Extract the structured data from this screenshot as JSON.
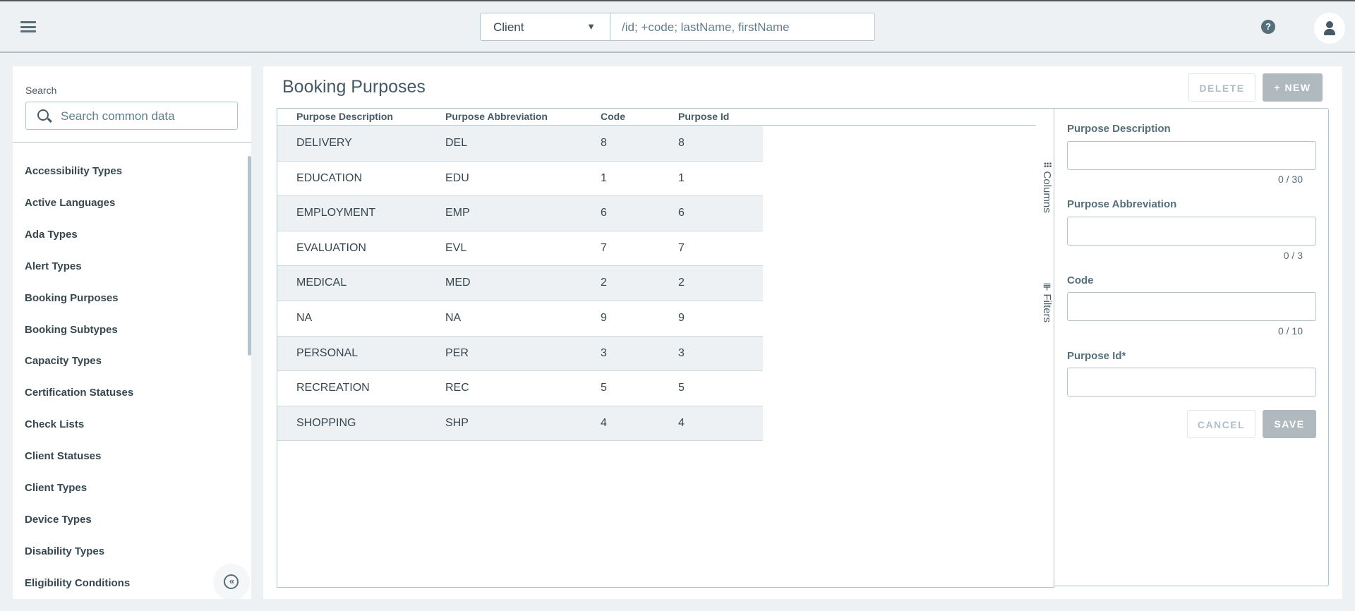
{
  "header": {
    "entity_select": "Client",
    "search_placeholder": "/id; +code; lastName, firstName",
    "help": "?"
  },
  "sidebar": {
    "search_label": "Search",
    "search_placeholder": "Search common data",
    "items": [
      "Accessibility Types",
      "Active Languages",
      "Ada Types",
      "Alert Types",
      "Booking Purposes",
      "Booking Subtypes",
      "Capacity Types",
      "Certification Statuses",
      "Check Lists",
      "Client Statuses",
      "Client Types",
      "Device Types",
      "Disability Types",
      "Eligibility Conditions"
    ],
    "collapse": "«"
  },
  "main": {
    "title": "Booking Purposes",
    "delete_label": "DELETE",
    "new_label": "+ NEW",
    "columns": [
      "Purpose Description",
      "Purpose Abbreviation",
      "Code",
      "Purpose Id"
    ],
    "rows": [
      [
        "DELIVERY",
        "DEL",
        "8",
        "8"
      ],
      [
        "EDUCATION",
        "EDU",
        "1",
        "1"
      ],
      [
        "EMPLOYMENT",
        "EMP",
        "6",
        "6"
      ],
      [
        "EVALUATION",
        "EVL",
        "7",
        "7"
      ],
      [
        "MEDICAL",
        "MED",
        "2",
        "2"
      ],
      [
        "NA",
        "NA",
        "9",
        "9"
      ],
      [
        "PERSONAL",
        "PER",
        "3",
        "3"
      ],
      [
        "RECREATION",
        "REC",
        "5",
        "5"
      ],
      [
        "SHOPPING",
        "SHP",
        "4",
        "4"
      ]
    ],
    "side_tabs": {
      "columns": "Columns",
      "filters": "Filters"
    }
  },
  "form": {
    "fields": [
      {
        "label": "Purpose Description",
        "value": "",
        "counter": "0 / 30"
      },
      {
        "label": "Purpose Abbreviation",
        "value": "",
        "counter": "0 / 3"
      },
      {
        "label": "Code",
        "value": "",
        "counter": "0 / 10"
      },
      {
        "label": "Purpose Id*",
        "value": ""
      }
    ],
    "cancel_label": "CANCEL",
    "save_label": "SAVE"
  }
}
